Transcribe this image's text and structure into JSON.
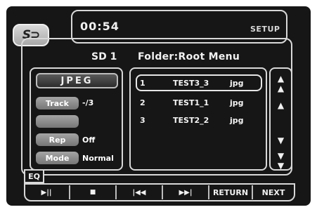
{
  "header": {
    "logo_text": "S⊃",
    "time": "00:54",
    "setup_label": "SETUP",
    "source": "SD 1",
    "folder_title": "Folder:Root Menu"
  },
  "info": {
    "format": "JPEG",
    "track_label": "Track",
    "track_value": "-/3",
    "blank_label": "",
    "rep_label": "Rep",
    "rep_value": "Off",
    "mode_label": "Mode",
    "mode_value": "Normal"
  },
  "file_list": [
    {
      "num": "1",
      "name": "TEST3_3",
      "ext": "jpg",
      "selected": true
    },
    {
      "num": "2",
      "name": "TEST1_1",
      "ext": "jpg",
      "selected": false
    },
    {
      "num": "3",
      "name": "TEST2_2",
      "ext": "jpg",
      "selected": false
    }
  ],
  "scroll": {
    "page_up_icon": "double-up-arrow-icon",
    "up_icon": "up-arrow-icon",
    "down_icon": "down-arrow-icon",
    "page_down_icon": "double-down-arrow-icon"
  },
  "eq_label": "EQ",
  "controls": {
    "play_pause_icon": "play-pause-icon",
    "stop_icon": "stop-icon",
    "prev_icon": "previous-icon",
    "next_track_icon": "next-track-icon",
    "return_label": "RETURN",
    "next_label": "NEXT"
  }
}
